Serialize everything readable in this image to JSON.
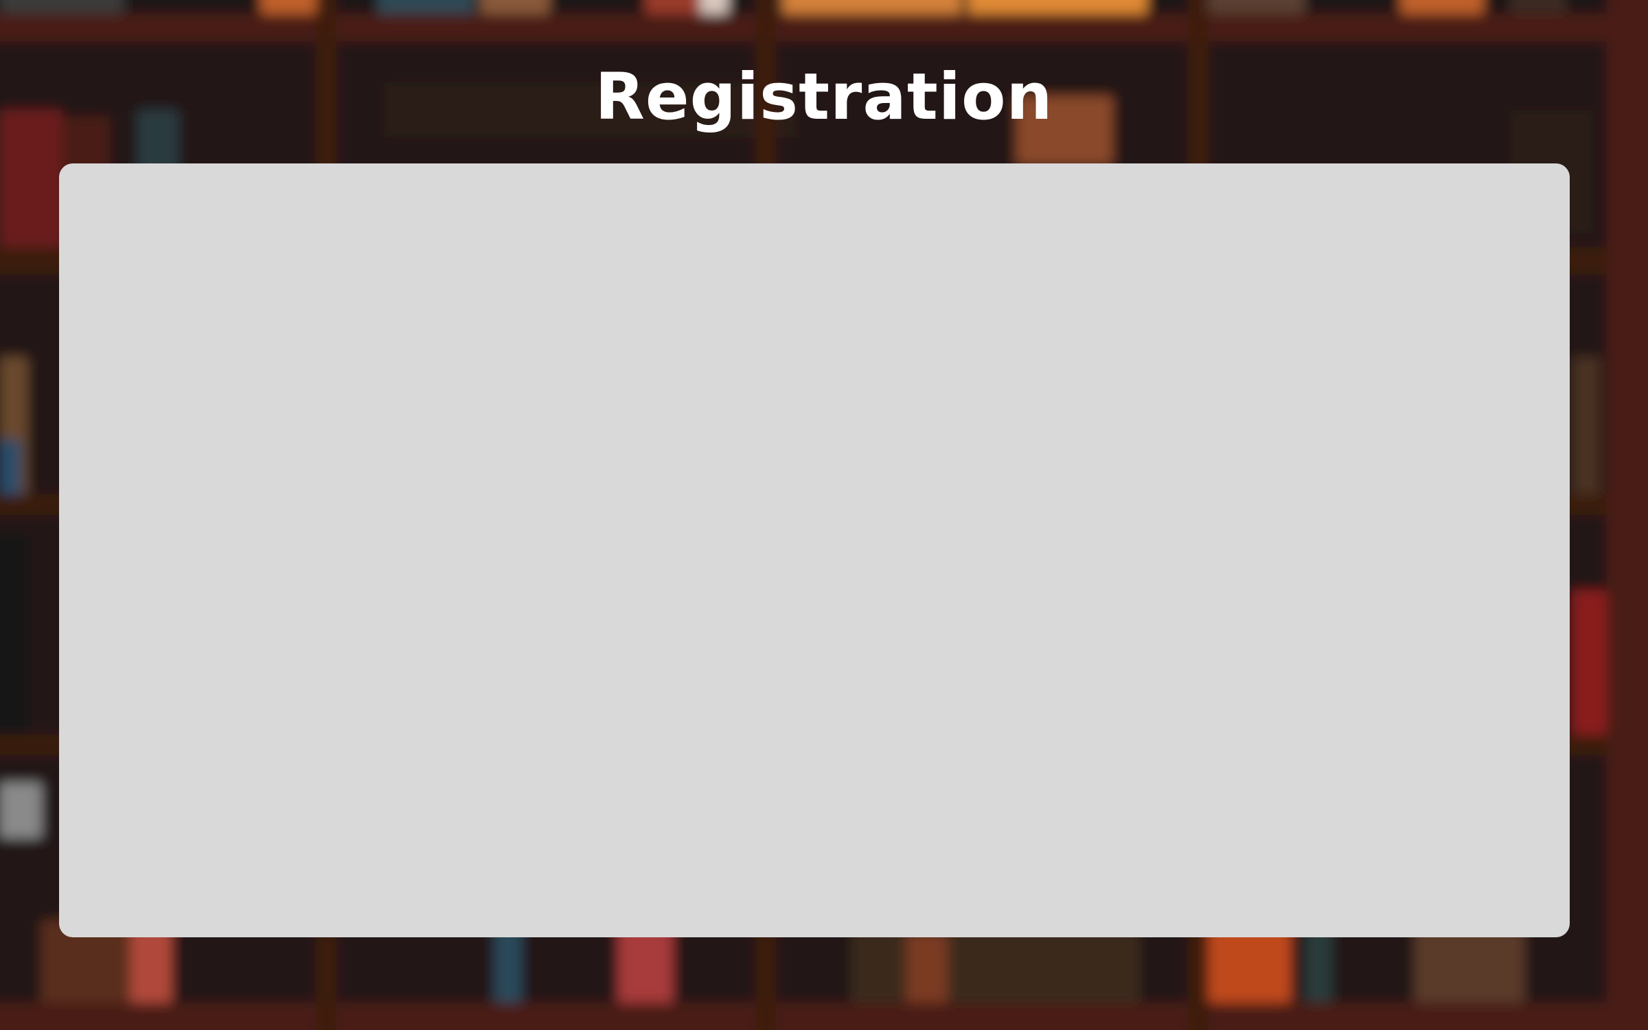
{
  "page": {
    "title": "Registration"
  },
  "background": {
    "description_icon": "bookshelf-background"
  },
  "panel": {
    "color": "#d9d9d9"
  },
  "colors": {
    "title": "#ffffff",
    "panel": "#d9d9d9",
    "shelf_wood": "#4a1f12"
  }
}
